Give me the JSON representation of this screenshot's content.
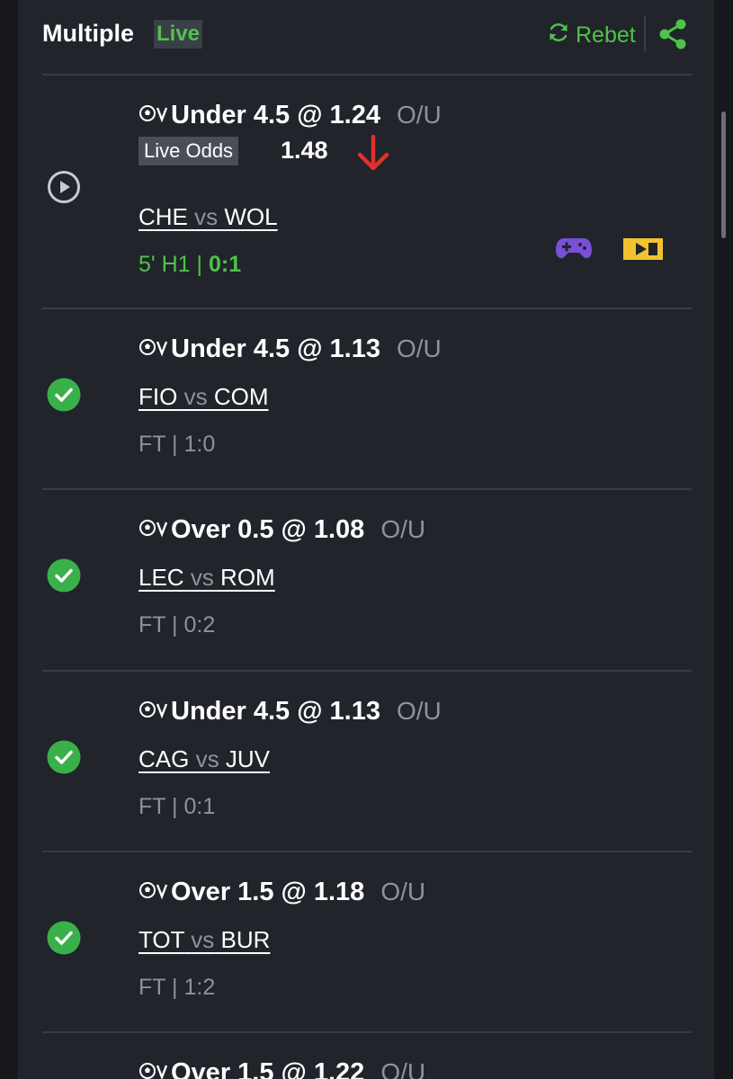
{
  "header": {
    "title": "Multiple",
    "live_badge": "Live",
    "rebet_label": "Rebet"
  },
  "legs": [
    {
      "selection": "Under 4.5 @ 1.24",
      "market": "O/U",
      "home": "CHE",
      "vs": "vs",
      "away": "WOL",
      "live_odds_label": "Live Odds",
      "live_odds_value": "1.48",
      "time_text": "5' H1 | ",
      "score_text": "0:1",
      "status": "live"
    },
    {
      "selection": "Under 4.5 @ 1.13",
      "market": "O/U",
      "home": "FIO",
      "vs": "vs",
      "away": "COM",
      "result": "FT | 1:0",
      "status": "won"
    },
    {
      "selection": "Over 0.5 @ 1.08",
      "market": "O/U",
      "home": "LEC",
      "vs": "vs",
      "away": "ROM",
      "result": "FT | 0:2",
      "status": "won"
    },
    {
      "selection": "Under 4.5 @ 1.13",
      "market": "O/U",
      "home": "CAG",
      "vs": "vs",
      "away": "JUV",
      "result": "FT | 0:1",
      "status": "won"
    },
    {
      "selection": "Over 1.5 @ 1.18",
      "market": "O/U",
      "home": "TOT",
      "vs": "vs",
      "away": "BUR",
      "result": "FT | 1:2",
      "status": "won"
    },
    {
      "selection": "Over 1.5 @ 1.22",
      "market": "O/U"
    }
  ],
  "colors": {
    "accent": "#4fc24a",
    "odds_down": "#e0312b",
    "background": "#21242a",
    "muted": "#8e929a"
  },
  "icons": [
    "refresh-icon",
    "share-icon",
    "play-icon",
    "soccer-ball-icon",
    "arrow-down-icon",
    "gamepad-icon",
    "live-stream-icon",
    "check-circle-icon"
  ]
}
